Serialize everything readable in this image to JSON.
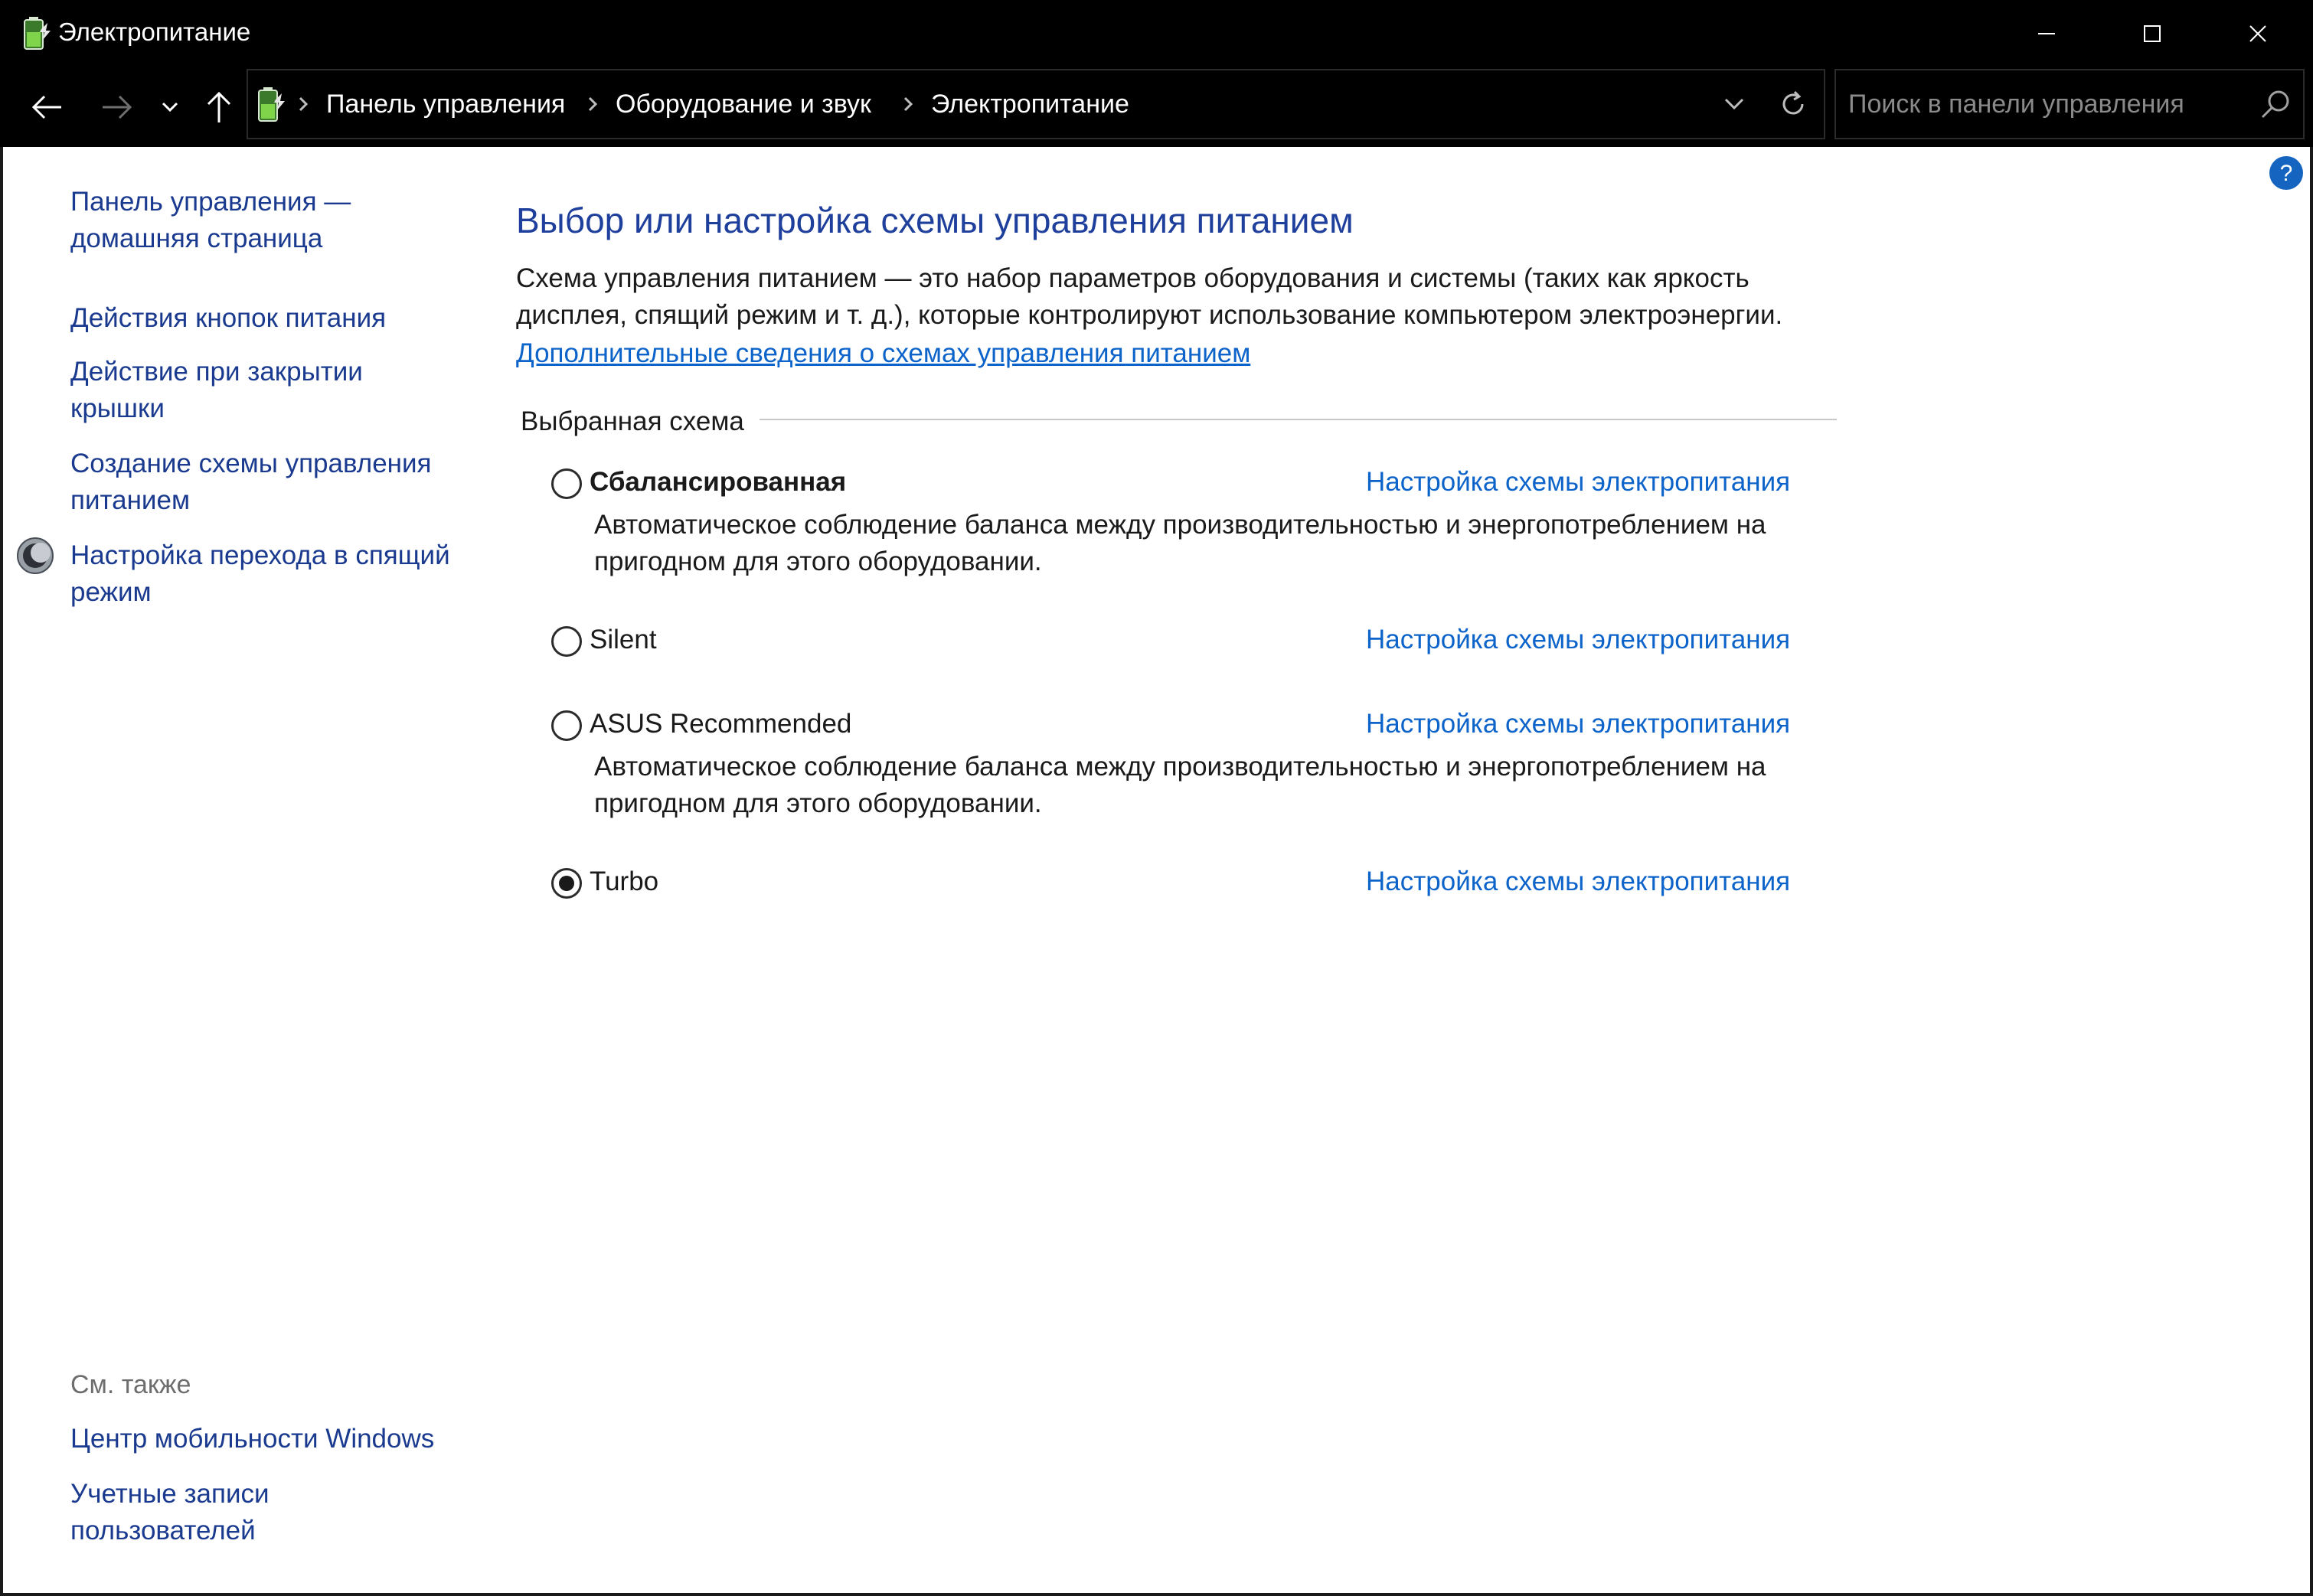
{
  "window": {
    "title": "Электропитание",
    "icon": "battery-power-icon"
  },
  "navigation": {
    "breadcrumbs": [
      "Панель управления",
      "Оборудование и звук",
      "Электропитание"
    ],
    "search_placeholder": "Поиск в панели управления"
  },
  "sidebar": {
    "links": [
      "Панель управления — домашняя страница",
      "Действия кнопок питания",
      "Действие при закрытии крышки",
      "Создание схемы управления питанием",
      "Настройка перехода в спящий режим"
    ],
    "see_also_title": "См. также",
    "see_also_links": [
      "Центр мобильности Windows",
      "Учетные записи пользователей"
    ]
  },
  "main": {
    "heading": "Выбор или настройка схемы управления питанием",
    "description": "Схема управления питанием — это набор параметров оборудования и системы (таких как яркость дисплея, спящий режим и т. д.), которые контролируют использование компьютером электроэнергии.",
    "more_info_link": "Дополнительные сведения о схемах управления питанием",
    "group_label": "Выбранная схема",
    "plans": [
      {
        "name": "Сбалансированная",
        "description": "Автоматическое соблюдение баланса между производительностью и энергопотреблением на пригодном для этого оборудовании.",
        "link": "Настройка схемы электропитания",
        "selected": false
      },
      {
        "name": "Silent",
        "description": "",
        "link": "Настройка схемы электропитания",
        "selected": false
      },
      {
        "name": "ASUS Recommended",
        "description": "Автоматическое соблюдение баланса между производительностью и энергопотреблением на пригодном для этого оборудовании.",
        "link": "Настройка схемы электропитания",
        "selected": false
      },
      {
        "name": "Turbo",
        "description": "",
        "link": "Настройка схемы электропитания",
        "selected": true
      }
    ]
  },
  "colors": {
    "chrome": "#000000",
    "heading": "#1e3f9c",
    "link": "#0c63c9",
    "sidebar_link": "#1a3a8f"
  }
}
